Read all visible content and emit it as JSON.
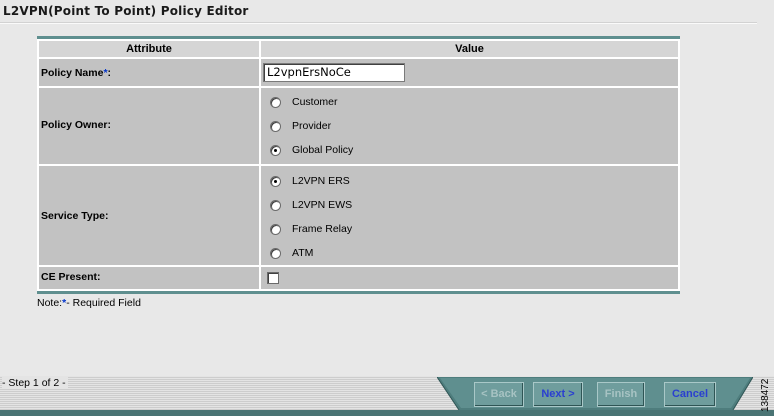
{
  "page_title": "L2VPN(Point To Point) Policy Editor",
  "table": {
    "headers": {
      "attribute": "Attribute",
      "value": "Value"
    },
    "required_mark": "*",
    "policy_name": {
      "label": "Policy Name",
      "suffix": ":",
      "value": "L2vpnErsNoCe"
    },
    "policy_owner": {
      "label": "Policy Owner:",
      "options": [
        "Customer",
        "Provider",
        "Global Policy"
      ],
      "selected": "Global Policy"
    },
    "service_type": {
      "label": "Service Type:",
      "options": [
        "L2VPN ERS",
        "L2VPN EWS",
        "Frame Relay",
        "ATM"
      ],
      "selected": "L2VPN ERS"
    },
    "ce_present": {
      "label": "CE Present:",
      "checked": false
    }
  },
  "note": {
    "prefix": "Note:",
    "mark": "*",
    "suffix": "- Required Field"
  },
  "footer": {
    "step": "- Step 1 of 2 -",
    "back": "< Back",
    "next": "Next >",
    "finish": "Finish",
    "cancel": "Cancel"
  },
  "side_id": "138472",
  "colors": {
    "teal_border": "#5f8f8f",
    "cell_gray": "#c2c2c2",
    "header_gray": "#d5d5d5",
    "button_teal": "#6f9d9d",
    "required_blue": "#0033cc"
  }
}
